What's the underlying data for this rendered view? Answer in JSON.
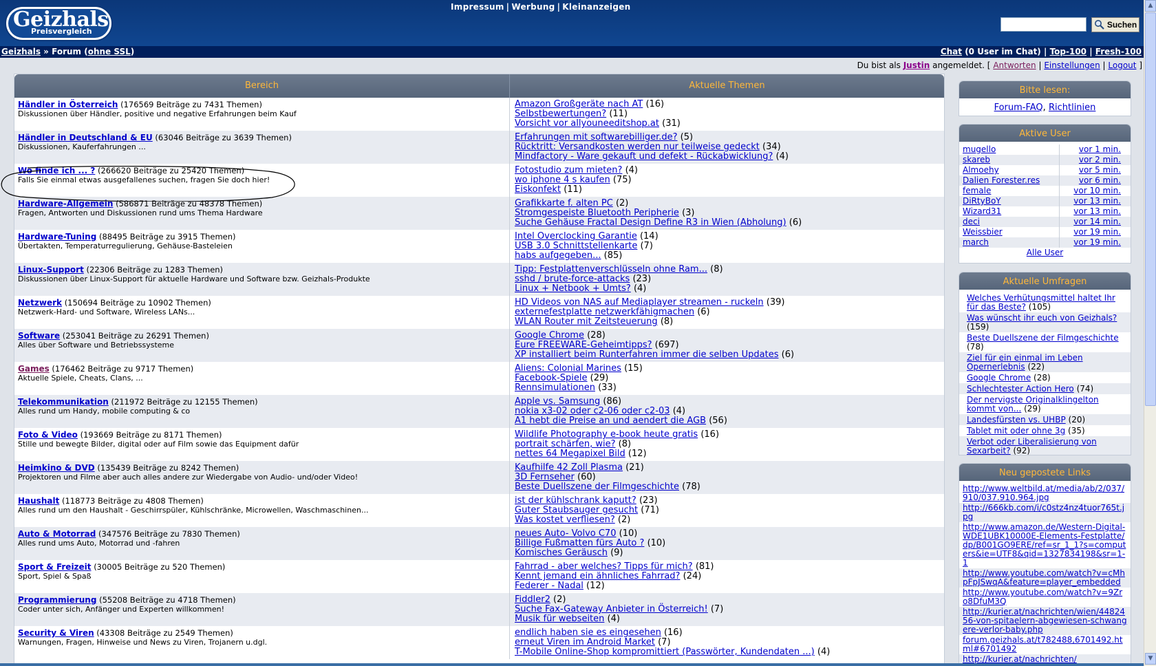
{
  "header": {
    "logo_main": "Geizhals",
    "logo_sub": "Preisvergleich",
    "menu": [
      "Impressum",
      "Werbung",
      "Kleinanzeigen"
    ],
    "search_placeholder": "",
    "search_button": "Suchen"
  },
  "crumb": {
    "home": "Geizhals",
    "sep": "»",
    "forum": "Forum",
    "ssl_open": "(",
    "ssl_link": "ohne SSL",
    "ssl_close": ")",
    "chat": "Chat",
    "chat_info": "(0 User im Chat)",
    "top100": "Top-100",
    "fresh100": "Fresh-100",
    "pipe": "|"
  },
  "login": {
    "prefix": "Du bist als",
    "user": "Justin",
    "suffix": "angemeldet. [",
    "answers": "Antworten",
    "settings": "Einstellungen",
    "logout": "Logout",
    "close": "]",
    "pipe": "|"
  },
  "table": {
    "col_left": "Bereich",
    "col_right": "Aktuelle Themen",
    "rows": [
      {
        "title": "Händler in Österreich",
        "count": "(176569 Beiträge zu 7431 Themen)",
        "desc": "Diskussionen über Händler, positive und negative Erfahrungen beim Kauf",
        "topics": [
          {
            "t": "Amazon Großgeräte nach AT",
            "n": "(16)"
          },
          {
            "t": "Selbstbewertungen?",
            "n": "(11)"
          },
          {
            "t": "Vorsicht vor allyouneeditshop.at",
            "n": "(31)"
          }
        ]
      },
      {
        "title": "Händler in Deutschland & EU",
        "count": "(63046 Beiträge zu 3639 Themen)",
        "desc": "Diskussionen, Kauferfahrungen ...",
        "topics": [
          {
            "t": "Erfahrungen mit softwarebilliger.de?",
            "n": "(5)"
          },
          {
            "t": "Rücktritt: Versandkosten werden nur teilweise gedeckt",
            "n": "(34)"
          },
          {
            "t": "Mindfactory - Ware gekauft und defekt - Rückabwicklung?",
            "n": "(4)"
          }
        ]
      },
      {
        "title": "Wo finde ich ... ?",
        "count": "(266620 Beiträge zu 25420 Themen)",
        "desc": "Falls Sie einmal etwas ausgefallenes suchen, fragen Sie doch hier!",
        "topics": [
          {
            "t": "Fotostudio zum mieten?",
            "n": "(4)"
          },
          {
            "t": "wo iphone 4 s kaufen",
            "n": "(75)"
          },
          {
            "t": "Eiskonfekt",
            "n": "(11)"
          }
        ]
      },
      {
        "title": "Hardware-Allgemein",
        "count": "(586871 Beiträge zu 48378 Themen)",
        "desc": "Fragen, Antworten und Diskussionen rund ums Thema Hardware",
        "topics": [
          {
            "t": "Grafikkarte f. alten PC",
            "n": "(2)"
          },
          {
            "t": "Stromgespeiste Bluetooth Peripherie",
            "n": "(3)"
          },
          {
            "t": "Suche Gehäuse Fractal Design Define R3 in Wien (Abholung)",
            "n": "(6)"
          }
        ]
      },
      {
        "title": "Hardware-Tuning",
        "count": "(88495 Beiträge zu 3915 Themen)",
        "desc": "Übertakten, Temperaturregulierung, Gehäuse-Basteleien",
        "topics": [
          {
            "t": "Intel Overclocking Garantie",
            "n": "(14)"
          },
          {
            "t": "USB 3.0 Schnittstellenkarte",
            "n": "(7)"
          },
          {
            "t": "habs aufgegeben...",
            "n": "(85)"
          }
        ]
      },
      {
        "title": "Linux-Support",
        "count": "(22306 Beiträge zu 1283 Themen)",
        "desc": "Diskussionen über Linux-Support für aktuelle Hardware und Software bzw. Geizhals-Produkte",
        "topics": [
          {
            "t": "Tipp: Festplattenverschlüsseln ohne Ram...",
            "n": "(8)"
          },
          {
            "t": "sshd / brute-force-attacks",
            "n": "(23)"
          },
          {
            "t": "Linux + Netbook + Umts?",
            "n": "(4)"
          }
        ]
      },
      {
        "title": "Netzwerk",
        "count": "(150694 Beiträge zu 10902 Themen)",
        "desc": "Netzwerk-Hard- und Software, Wireless LANs...",
        "topics": [
          {
            "t": "HD Videos von NAS auf Mediaplayer streamen - ruckeln",
            "n": "(39)"
          },
          {
            "t": "externefestplatte netzwerkfähigmachen",
            "n": "(6)"
          },
          {
            "t": "WLAN Router mit Zeitsteuerung",
            "n": "(8)"
          }
        ]
      },
      {
        "title": "Software",
        "count": "(253041 Beiträge zu 26291 Themen)",
        "desc": "Alles über Software und Betriebssysteme",
        "topics": [
          {
            "t": "Google Chrome",
            "n": "(28)"
          },
          {
            "t": "Eure FREEWARE-Geheimtipps?",
            "n": "(697)"
          },
          {
            "t": "XP installiert beim Runterfahren immer die selben Updates",
            "n": "(6)"
          }
        ]
      },
      {
        "title": "Games",
        "count": "(176462 Beiträge zu 9717 Themen)",
        "desc": "Aktuelle Spiele, Cheats, Clans, ...",
        "visited": true,
        "topics": [
          {
            "t": "Aliens: Colonial Marines",
            "n": "(15)"
          },
          {
            "t": "Facebook-Spiele",
            "n": "(29)"
          },
          {
            "t": "Rennsimulationen",
            "n": "(33)"
          }
        ]
      },
      {
        "title": "Telekommunikation",
        "count": "(211972 Beiträge zu 12155 Themen)",
        "desc": "Alles rund um Handy, mobile computing & co",
        "topics": [
          {
            "t": "Apple vs. Samsung",
            "n": "(86)"
          },
          {
            "t": "nokia x3-02 oder c2-06 oder c2-03",
            "n": "(4)"
          },
          {
            "t": "A1 hebt die Preise an und aendert die AGB",
            "n": "(56)"
          }
        ]
      },
      {
        "title": "Foto & Video",
        "count": "(193669 Beiträge zu 8171 Themen)",
        "desc": "Stille und bewegte Bilder, digital oder auf Film sowie das Equipment dafür",
        "topics": [
          {
            "t": "Wildlife Photography e-book heute gratis",
            "n": "(16)"
          },
          {
            "t": "portrait schärfen, wie?",
            "n": "(8)"
          },
          {
            "t": "nettes 64 Megapixel Bild",
            "n": "(12)"
          }
        ]
      },
      {
        "title": "Heimkino & DVD",
        "count": "(135439 Beiträge zu 8242 Themen)",
        "desc": "Projektoren und Filme aber auch alles andere zur Wiedergabe von Audio- und/oder Video!",
        "topics": [
          {
            "t": "Kaufhilfe 42 Zoll Plasma",
            "n": "(21)"
          },
          {
            "t": "3D Fernseher",
            "n": "(60)"
          },
          {
            "t": "Beste Duellszene der Filmgeschichte",
            "n": "(78)"
          }
        ]
      },
      {
        "title": "Haushalt",
        "count": "(118773 Beiträge zu 4808 Themen)",
        "desc": "Alles rund um den Haushalt - Geschirrspüler, Kühlschränke, Microwellen, Waschmaschinen...",
        "topics": [
          {
            "t": "ist der kühlschrank kaputt?",
            "n": "(23)"
          },
          {
            "t": "Guter Staubsauger gesucht",
            "n": "(71)"
          },
          {
            "t": "Was kostet verfliesen?",
            "n": "(2)"
          }
        ]
      },
      {
        "title": "Auto & Motorrad",
        "count": "(347576 Beiträge zu 7830 Themen)",
        "desc": "Alles rund ums Auto, Motorrad und -fahren",
        "topics": [
          {
            "t": "neues Auto- Volvo C70",
            "n": "(10)"
          },
          {
            "t": "Billige Fußmatten fürs Auto ?",
            "n": "(10)"
          },
          {
            "t": "Komisches Geräusch",
            "n": "(9)"
          }
        ]
      },
      {
        "title": "Sport & Freizeit",
        "count": "(30005 Beiträge zu 520 Themen)",
        "desc": "Sport, Spiel & Spaß",
        "topics": [
          {
            "t": "Fahrrad - aber welches? Tipps für mich?",
            "n": "(81)"
          },
          {
            "t": "Kennt jemand ein ähnliches Fahrrad?",
            "n": "(24)"
          },
          {
            "t": "Federer - Nadal",
            "n": "(12)"
          }
        ]
      },
      {
        "title": "Programmierung",
        "count": "(55208 Beiträge zu 4718 Themen)",
        "desc": "Coder unter sich, Anfänger und Experten willkommen!",
        "topics": [
          {
            "t": "Fiddler2",
            "n": "(2)"
          },
          {
            "t": "Suche Fax-Gateway Anbieter in Österreich!",
            "n": "(7)"
          },
          {
            "t": "Musik für webseiten",
            "n": "(4)"
          }
        ]
      },
      {
        "title": "Security & Viren",
        "count": "(43308 Beiträge zu 2549 Themen)",
        "desc": "Warnungen, Fragen, Hinweise und News zu Viren, Trojanern u.dgl.",
        "topics": [
          {
            "t": "endlich haben sie es eingesehen",
            "n": "(16)"
          },
          {
            "t": "erneut Viren im Android Market",
            "n": "(7)"
          },
          {
            "t": "T-Mobile Online-Shop kompromittiert (Passwörter, Kundendaten ...)",
            "n": "(4)"
          }
        ]
      }
    ]
  },
  "sidebar": {
    "read": {
      "title": "Bitte lesen:",
      "faq": "Forum-FAQ",
      "comma": ",",
      "rules": "Richtlinien"
    },
    "users": {
      "title": "Aktive User",
      "list": [
        {
          "name": "mugello",
          "time": "vor 1 min."
        },
        {
          "name": "skareb",
          "time": "vor 2 min."
        },
        {
          "name": "Almoehy",
          "time": "vor 5 min."
        },
        {
          "name": "Dalien Forester.res",
          "time": "vor 6 min."
        },
        {
          "name": "female",
          "time": "vor 10 min."
        },
        {
          "name": "DiRtyBoY",
          "time": "vor 13 min."
        },
        {
          "name": "Wizard31",
          "time": "vor 13 min."
        },
        {
          "name": "deci",
          "time": "vor 14 min."
        },
        {
          "name": "Weissbier",
          "time": "vor 19 min."
        },
        {
          "name": "march",
          "time": "vor 19 min."
        }
      ],
      "all": "Alle User"
    },
    "polls": {
      "title": "Aktuelle Umfragen",
      "list": [
        {
          "t": "Welches Verhütungsmittel haltet Ihr für das Beste?",
          "n": "(105)"
        },
        {
          "t": "Was wünscht ihr euch von Geizhals?",
          "n": "(159)"
        },
        {
          "t": "Beste Duellszene der Filmgeschichte",
          "n": "(78)"
        },
        {
          "t": "Ziel für ein einmal im Leben Opernerlebnis",
          "n": "(22)"
        },
        {
          "t": "Google Chrome",
          "n": "(28)"
        },
        {
          "t": "Schlechtester Action Hero",
          "n": "(74)"
        },
        {
          "t": "Der nervigste Originalklingelton kommt von...",
          "n": "(29)"
        },
        {
          "t": "Landesfürsten vs. UHBP",
          "n": "(20)"
        },
        {
          "t": "Tablet mit oder ohne 3g",
          "n": "(35)"
        },
        {
          "t": "Verbot oder Liberalisierung von Sexarbeit?",
          "n": "(92)"
        }
      ]
    },
    "links": {
      "title": "Neu gepostete Links",
      "list": [
        "http://www.weltbild.at/media/ab/2/037/910/037.910.964.jpg",
        "http://666kb.com/i/c0stz4nz4tuor765t.jpg",
        "http://www.amazon.de/Western-Digital-WDE1UBK10000E-Elements-Festplatte/dp/B001GO9ERE/ref=sr_1_1?s=computers&ie=UTF8&qid=1327834198&sr=1-1",
        "http://www.youtube.com/watch?v=cMhpFpJSwqA&feature=player_embedded",
        "http://www.youtube.com/watch?v=9Zro8DfuM3Q",
        "http://kurier.at/nachrichten/wien/4482456-von-spitaelern-abgewiesen-schwangere-verlor-baby.php",
        "forum.geizhals.at/t782488,6701492.html#6701492",
        "http://kurier.at/nachrichten/"
      ]
    }
  }
}
